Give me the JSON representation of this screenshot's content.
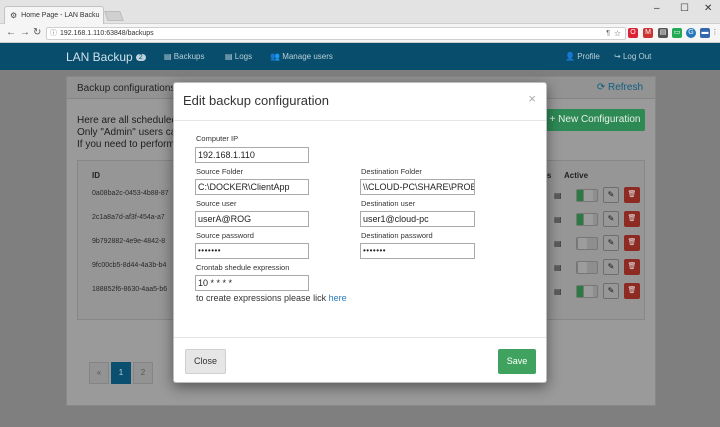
{
  "browser": {
    "tab_title": "Home Page - LAN Backu",
    "tab_close": "×",
    "url": "192.168.1.110:63848/backups",
    "window_controls": [
      "–",
      "☐",
      "✕"
    ]
  },
  "navbar": {
    "brand": "LAN Backup",
    "brand_badge": "2",
    "links": [
      "Backups",
      "Logs",
      "Manage users"
    ],
    "profile": "Profile",
    "logout": "Log Out"
  },
  "panel": {
    "title": "Backup configurations",
    "refresh": "Refresh",
    "info_lines": [
      "Here are all scheduled",
      "Only \"Admin\" users ca",
      "If you need to perform"
    ],
    "new_button": "New Configuration"
  },
  "table": {
    "headers": {
      "id": "ID",
      "logs": "gs",
      "active": "Active"
    },
    "rows": [
      {
        "id": "0a08ba2c-0453-4b88-87",
        "active": true
      },
      {
        "id": "2c1a8a7d-af3f-454a-a7",
        "active": true
      },
      {
        "id": "9b792882-4e9e-4842-8",
        "active": false
      },
      {
        "id": "9fc00cb5-8d44-4a3b-b4",
        "active": false
      },
      {
        "id": "188852f6-8630-4aa5-b6",
        "active": true
      }
    ]
  },
  "pagination": {
    "prev": "«",
    "pages": [
      "1",
      "2"
    ],
    "current": "1"
  },
  "modal": {
    "title": "Edit backup configuration",
    "close_x": "×",
    "fields": {
      "computer_ip": {
        "label": "Computer IP",
        "value": "192.168.1.110"
      },
      "source_folder": {
        "label": "Source Folder",
        "value": "C:\\DOCKER\\ClientApp"
      },
      "destination_folder": {
        "label": "Destination Folder",
        "value": "\\\\CLOUD-PC\\SHARE\\PROB"
      },
      "source_user": {
        "label": "Source user",
        "value": "userA@ROG"
      },
      "destination_user": {
        "label": "Destination user",
        "value": "user1@cloud-pc"
      },
      "source_password": {
        "label": "Source password",
        "value": "•••••••"
      },
      "destination_password": {
        "label": "Destination password",
        "value": "•••••••"
      },
      "crontab": {
        "label": "Crontab shedule expression",
        "value": "10 * * * *"
      }
    },
    "help_text": "to create expressions please lick ",
    "help_link": "here",
    "close_button": "Close",
    "save_button": "Save"
  }
}
